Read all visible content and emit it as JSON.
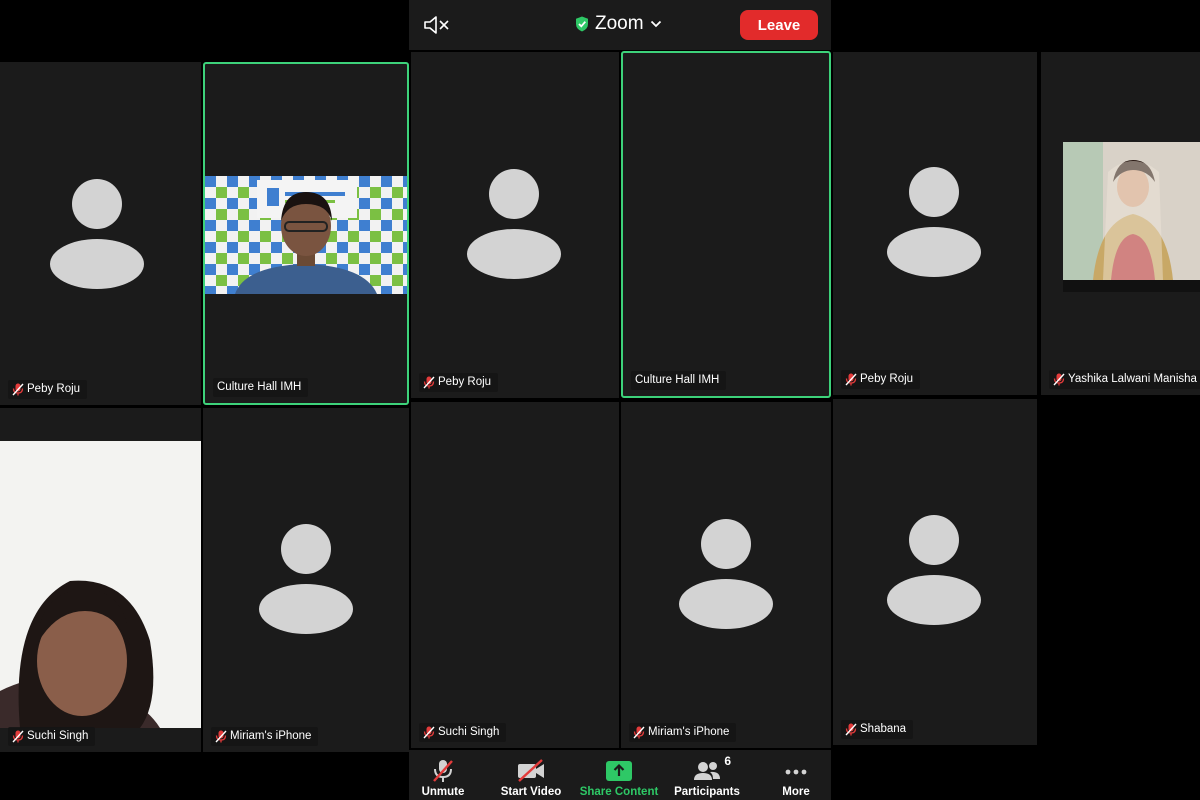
{
  "topbar": {
    "app_title": "Zoom",
    "leave_label": "Leave"
  },
  "tiles": [
    {
      "name": "Peby Roju"
    },
    {
      "name": "Culture Hall IMH"
    },
    {
      "name": "Peby Roju"
    },
    {
      "name": "Culture Hall IMH"
    },
    {
      "name": "Peby Roju"
    },
    {
      "name": "Yashika Lalwani Manisha L"
    },
    {
      "name": "Suchi Singh"
    },
    {
      "name": "Miriam's iPhone"
    },
    {
      "name": "Suchi Singh"
    },
    {
      "name": "Miriam's iPhone"
    },
    {
      "name": "Shabana"
    }
  ],
  "toolbar": {
    "unmute_label": "Unmute",
    "start_video_label": "Start Video",
    "share_label": "Share Content",
    "participants_label": "Participants",
    "participants_count": "6",
    "more_label": "More"
  },
  "colors": {
    "active_border": "#3dd27a",
    "leave_bg": "#e22b2b",
    "share_green": "#2ec866",
    "mic_muted_red": "#e33b3b"
  }
}
